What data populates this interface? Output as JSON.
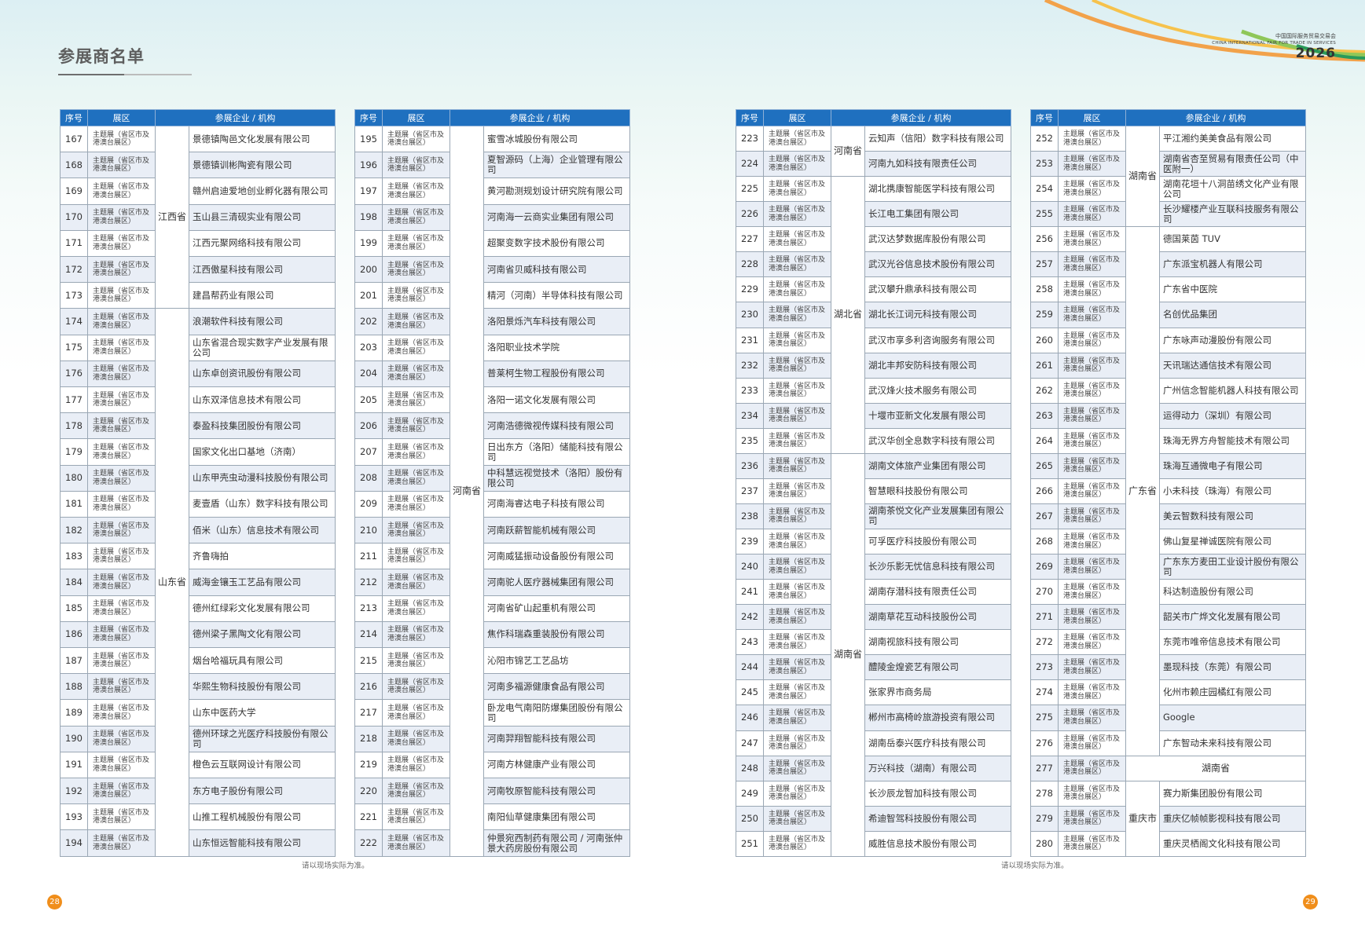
{
  "header": {
    "title": "参展商名单",
    "logo_cn": "中国国际服务贸易交易会",
    "logo_en": "CHINA INTERNATIONAL FAIR FOR TRADE IN SERVICES",
    "logo_year": "2026"
  },
  "table_headers": {
    "seq": "序号",
    "zone": "展区",
    "company": "参展企业 / 机构"
  },
  "zone_label": "主题展（省区市及港澳台展区）",
  "tables": [
    {
      "start": 167,
      "rows": [
        "景德镇陶邑文化发展有限公司",
        "景德镇训彬陶瓷有限公司",
        "赣州启迪爱地创业孵化器有限公司",
        "玉山县三清砚实业有限公司",
        "江西元聚网络科技有限公司",
        "江西傲星科技有限公司",
        "建昌帮药业有限公司",
        "浪潮软件科技有限公司",
        "山东省混合现实数字产业发展有限公司",
        "山东卓创资讯股份有限公司",
        "山东双泽信息技术有限公司",
        "泰盈科技集团股份有限公司",
        "国家文化出口基地（济南）",
        "山东甲壳虫动漫科技股份有限公司",
        "麦壹盾（山东）数字科技有限公司",
        "佰米（山东）信息技术有限公司",
        "齐鲁嗨拍",
        "威海金镶玉工艺品有限公司",
        "德州红绿彩文化发展有限公司",
        "德州梁子黑陶文化有限公司",
        "烟台哈福玩具有限公司",
        "华熙生物科技股份有限公司",
        "山东中医药大学",
        "德州环球之光医疗科技股份有限公司",
        "橙色云互联网设计有限公司",
        "东方电子股份有限公司",
        "山推工程机械股份有限公司",
        "山东恒远智能科技有限公司"
      ],
      "provinces": [
        {
          "name": "江西省",
          "span": 7
        },
        {
          "name": "山东省",
          "span": 21
        }
      ]
    },
    {
      "start": 195,
      "rows": [
        "蜜雪冰城股份有限公司",
        "夏智源码（上海）企业管理有限公司",
        "黄河勘测规划设计研究院有限公司",
        "河南海一云商实业集团有限公司",
        "超聚变数字技术股份有限公司",
        "河南省贝威科技有限公司",
        "精河（河南）半导体科技有限公司",
        "洛阳景烁汽车科技有限公司",
        "洛阳职业技术学院",
        "普莱柯生物工程股份有限公司",
        "洛阳一诺文化发展有限公司",
        "河南浩德微视传媒科技有限公司",
        "日出东方（洛阳）储能科技有限公司",
        "中科慧远视觉技术（洛阳）股份有限公司",
        "河南海睿达电子科技有限公司",
        "河南跃薪智能机械有限公司",
        "河南威猛振动设备股份有限公司",
        "河南驼人医疗器械集团有限公司",
        "河南省矿山起重机有限公司",
        "焦作科瑞森重装股份有限公司",
        "沁阳市锦艺工艺品坊",
        "河南多福源健康食品有限公司",
        "卧龙电气南阳防爆集团股份有限公司",
        "河南羿翔智能科技有限公司",
        "河南方林健康产业有限公司",
        "河南牧原智能科技有限公司",
        "南阳仙草健康集团有限公司",
        "仲景宛西制药有限公司 / 河南张仲景大药房股份有限公司"
      ],
      "provinces": [
        {
          "name": "河南省",
          "span": 28
        }
      ]
    },
    {
      "start": 223,
      "rows": [
        "云知声（信阳）数字科技有限公司",
        "河南九如科技有限责任公司",
        "湖北携康智能医学科技有限公司",
        "长江电工集团有限公司",
        "武汉达梦数据库股份有限公司",
        "武汉光谷信息技术股份有限公司",
        "武汉攀升鼎承科技有限公司",
        "湖北长江词元科技有限公司",
        "武汉市享多利咨询服务有限公司",
        "湖北丰邦安防科技有限公司",
        "武汉烽火技术服务有限公司",
        "十堰市亚新文化发展有限公司",
        "武汉华创全息数字科技有限公司",
        "湖南文体旅产业集团有限公司",
        "智慧眼科技股份有限公司",
        "湖南茶悦文化产业发展集团有限公司",
        "可孚医疗科技股份有限公司",
        "长沙乐影无忧信息科技有限公司",
        "湖南存潜科技有限责任公司",
        "湖南草花互动科技股份公司",
        "湖南视旅科技有限公司",
        "醴陵金煌瓷艺有限公司",
        "张家界市商务局",
        "郴州市高椅岭旅游投资有限公司",
        "湖南岳泰兴医疗科技有限公司",
        "万兴科技（湖南）有限公司",
        "长沙辰龙智加科技有限公司",
        "希迪智驾科技股份有限公司",
        "威胜信息技术股份有限公司"
      ],
      "provinces": [
        {
          "name": "河南省",
          "span": 2
        },
        {
          "name": "湖北省",
          "span": 11
        },
        {
          "name": "湖南省",
          "span": 16
        }
      ]
    },
    {
      "start": 252,
      "rows": [
        "平江湘约美美食品有限公司",
        "湖南省杏至贸易有限责任公司（中医附一）",
        "湖南花垣十八洞苗绣文化产业有限公司",
        "长沙耀楼产业互联科技服务有限公司",
        "德国莱茵 TUV",
        "广东派宝机器人有限公司",
        "广东省中医院",
        "名创优品集团",
        "广东咏声动漫股份有限公司",
        "天讯瑞达通信技术有限公司",
        "广州信念智能机器人科技有限公司",
        "运得动力（深圳）有限公司",
        "珠海无界方舟智能技术有限公司",
        "珠海互通微电子有限公司",
        "小未科技（珠海）有限公司",
        "美云智数科技有限公司",
        "佛山复星禅诚医院有限公司",
        "广东东方麦田工业设计股份有限公司",
        "科达制造股份有限公司",
        "韶关市广烨文化发展有限公司",
        "东莞市唯帝信息技术有限公司",
        "墨现科技（东莞）有限公司",
        "化州市赖庄园橘红有限公司",
        "Google",
        "广东智动未来科技有限公司",
        "湖南省",
        "赛力斯集团股份有限公司",
        "重庆亿帧帧影视科技有限公司",
        "重庆灵栖阁文化科技有限公司"
      ],
      "provinces": [
        {
          "name": "湖南省",
          "span": 4
        },
        {
          "name": "广东省",
          "span": 21
        },
        {
          "name": "",
          "span": 1,
          "full": true
        },
        {
          "name": "重庆市",
          "span": 3
        }
      ]
    }
  ],
  "footer": {
    "note": "请以现场实际为准。",
    "page_left": "28",
    "page_right": "29"
  }
}
